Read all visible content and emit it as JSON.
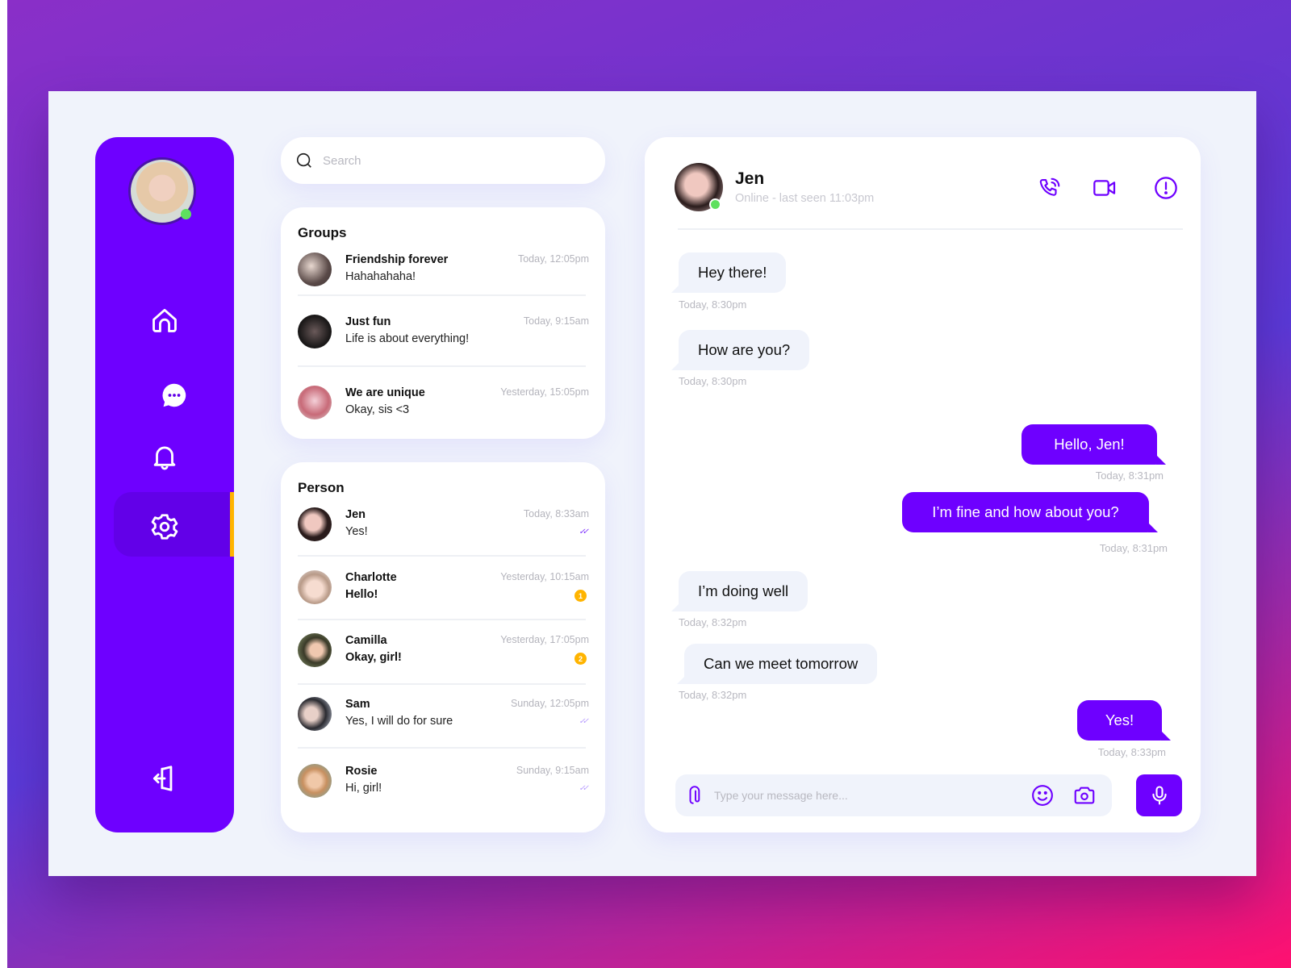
{
  "colors": {
    "accent": "#6e00ff",
    "active_indicator": "#ffb400",
    "online": "#5ee05e",
    "badge": "#ffb400"
  },
  "sidebar": {
    "items": [
      {
        "icon": "home-icon"
      },
      {
        "icon": "chat-icon",
        "active": true
      },
      {
        "icon": "bell-icon"
      },
      {
        "icon": "gear-icon"
      }
    ],
    "logout_icon": "logout-icon"
  },
  "search": {
    "placeholder": "Search"
  },
  "groups": {
    "title": "Groups",
    "items": [
      {
        "name": "Friendship forever",
        "message": "Hahahahaha!",
        "time": "Today, 12:05pm"
      },
      {
        "name": "Just fun",
        "message": "Life is about everything!",
        "time": "Today, 9:15am"
      },
      {
        "name": "We are unique",
        "message": "Okay, sis <3",
        "time": "Yesterday, 15:05pm"
      }
    ]
  },
  "persons": {
    "title": "Person",
    "items": [
      {
        "name": "Jen",
        "message": "Yes!",
        "time": "Today, 8:33am",
        "status": "read"
      },
      {
        "name": "Charlotte",
        "message": "Hello!",
        "time": "Yesterday, 10:15am",
        "unread": "1"
      },
      {
        "name": "Camilla",
        "message": "Okay, girl!",
        "time": "Yesterday, 17:05pm",
        "unread": "2"
      },
      {
        "name": "Sam",
        "message": "Yes, I will do for sure",
        "time": "Sunday, 12:05pm",
        "status": "delivered"
      },
      {
        "name": "Rosie",
        "message": "Hi, girl!",
        "time": "Sunday, 9:15am",
        "status": "delivered"
      }
    ]
  },
  "chat": {
    "name": "Jen",
    "status": "Online - last seen 11:03pm",
    "actions": [
      "phone-icon",
      "video-icon",
      "info-icon"
    ],
    "messages": [
      {
        "side": "in",
        "text": "Hey there!",
        "time": "Today, 8:30pm"
      },
      {
        "side": "in",
        "text": "How are you?",
        "time": "Today, 8:30pm"
      },
      {
        "side": "out",
        "text": "Hello, Jen!",
        "time": "Today, 8:31pm"
      },
      {
        "side": "out",
        "text": "I’m fine and how about you?",
        "time": "Today, 8:31pm"
      },
      {
        "side": "in",
        "text": "I’m doing well",
        "time": "Today, 8:32pm"
      },
      {
        "side": "in",
        "text": "Can we meet tomorrow",
        "time": "Today, 8:32pm"
      },
      {
        "side": "out",
        "text": "Yes!",
        "time": "Today, 8:33pm"
      }
    ],
    "input_placeholder": "Type your message here..."
  }
}
